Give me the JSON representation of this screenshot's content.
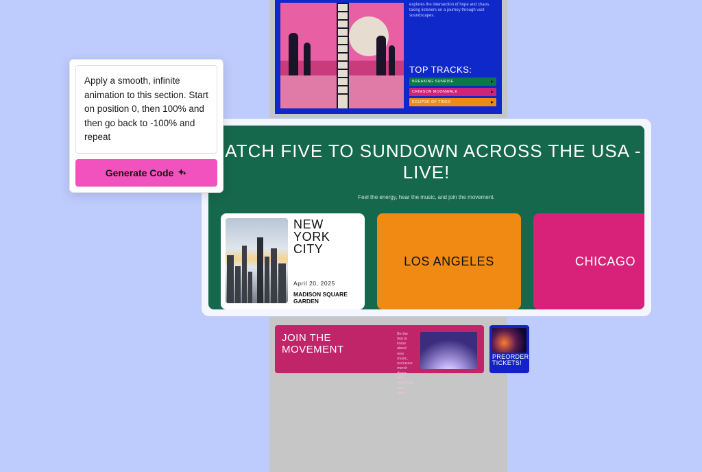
{
  "prompt": {
    "text": "Apply a smooth, infinite animation to this section. Start on position 0, then 100% and then go back to -100% and repeat",
    "button_label": "Generate Code"
  },
  "album": {
    "description": "explores the intersection of hope and chaos, taking listeners on a journey through vast soundscapes.",
    "top_tracks_label": "TOP TRACKS:",
    "tracks": [
      {
        "name": "BREAKING SUNRISE"
      },
      {
        "name": "CRIMSON MOONWALK"
      },
      {
        "name": "ECLIPSE OF TIDES"
      }
    ]
  },
  "tour": {
    "title": "CATCH FIVE TO SUNDOWN ACROSS THE USA - LIVE!",
    "subtitle": "Feel the energy, hear the music, and join the movement.",
    "stops": [
      {
        "city": "NEW YORK CITY",
        "date": "April 20, 2025",
        "venue": "MADISON SQUARE GARDEN"
      },
      {
        "city": "LOS ANGELES"
      },
      {
        "city": "CHICAGO"
      }
    ]
  },
  "join": {
    "title": "JOIN THE MOVEMENT",
    "desc": "Be the first to know about new music, exclusive merch drops, and upcoming tour dates."
  },
  "preorder": {
    "title": "PREORDER TICKETS!"
  },
  "colors": {
    "bg": "#beccfd",
    "teal": "#16684c",
    "orange": "#f08a12",
    "magenta": "#d82279",
    "blue": "#0f28c9",
    "pinkBtn": "#f252bd"
  }
}
